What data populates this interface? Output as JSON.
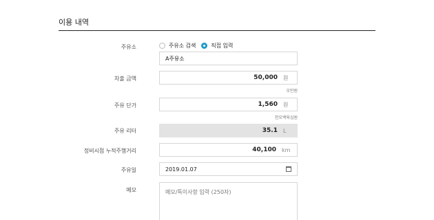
{
  "page": {
    "title": "이용 내역"
  },
  "form": {
    "station": {
      "label": "주유소",
      "radio_search": "주유소 검색",
      "radio_direct": "직접 입력",
      "selected": "direct",
      "value": "A주유소"
    },
    "amount": {
      "label": "차출 금액",
      "value": "50,000",
      "unit": "원",
      "hint": "오만원"
    },
    "unit_price": {
      "label": "주유 단가",
      "value": "1,560",
      "unit": "원",
      "hint": "천오백육십원"
    },
    "liters": {
      "label": "주유 리터",
      "value": "35.1",
      "unit": "L"
    },
    "odometer": {
      "label": "정비시점 누적주행거리",
      "value": "40,100",
      "unit": "km"
    },
    "date": {
      "label": "주유일",
      "value": "2019.01.07"
    },
    "memo": {
      "label": "메모",
      "placeholder": "메모/특이사항 입력 (250자)"
    }
  }
}
